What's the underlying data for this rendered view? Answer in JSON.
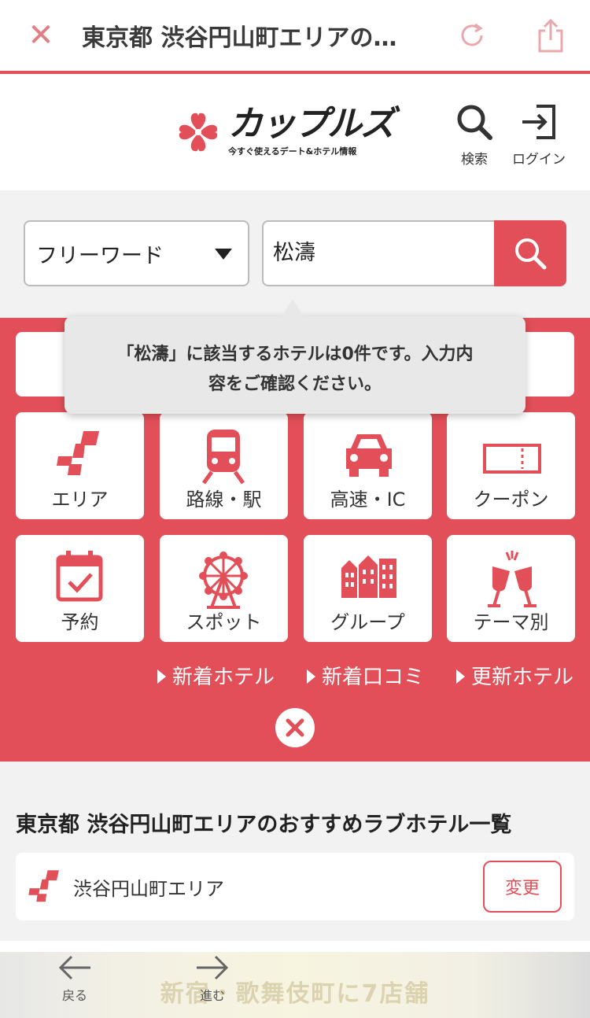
{
  "browser": {
    "title": "東京都 渋谷円山町エリアの…"
  },
  "header": {
    "logo_title": "カップルズ",
    "logo_subtitle": "今すぐ使えるデート&ホテル情報",
    "search_label": "検索",
    "login_label": "ログイン"
  },
  "search": {
    "type_selected": "フリーワード",
    "query_value": "松濤"
  },
  "tooltip": {
    "line1": "「松濤」に該当するホテルは0件です。入力内",
    "line2": "容をご確認ください。"
  },
  "menu": {
    "tiles": [
      {
        "label": "エリア",
        "icon": "area-map-icon"
      },
      {
        "label": "路線・駅",
        "icon": "train-icon"
      },
      {
        "label": "高速・IC",
        "icon": "car-icon"
      },
      {
        "label": "クーポン",
        "icon": "ticket-icon"
      },
      {
        "label": "予約",
        "icon": "calendar-check-icon"
      },
      {
        "label": "スポット",
        "icon": "ferris-wheel-icon"
      },
      {
        "label": "グループ",
        "icon": "buildings-icon"
      },
      {
        "label": "テーマ別",
        "icon": "champagne-glasses-icon"
      }
    ],
    "links": [
      "新着ホテル",
      "新着口コミ",
      "更新ホテル"
    ]
  },
  "list": {
    "section_title": "東京都 渋谷円山町エリアのおすすめラブホテル一覧",
    "area_name": "渋谷円山町エリア",
    "change_label": "変更"
  },
  "bottom_bar": {
    "back_label": "戻る",
    "forward_label": "進む",
    "banner_text": "新宿・歌舞伎町に7店舗"
  },
  "colors": {
    "brand_red": "#e24f58",
    "background": "#f2f2f2"
  }
}
